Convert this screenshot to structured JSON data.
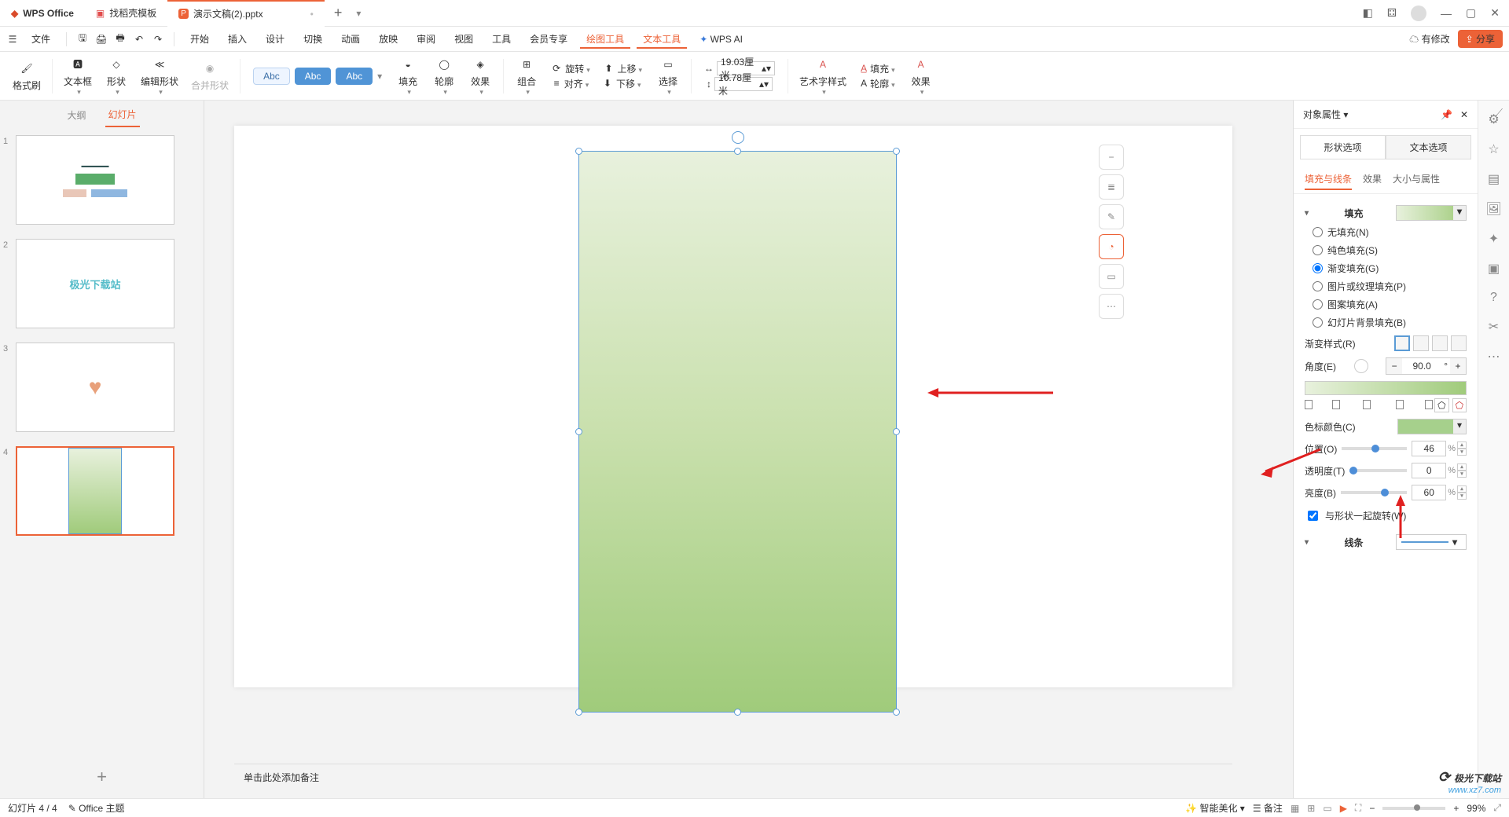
{
  "titlebar": {
    "office_tab": "WPS Office",
    "template_tab": "找稻壳模板",
    "doc_tab": "演示文稿(2).pptx"
  },
  "menubar": {
    "file": "文件",
    "items": [
      "开始",
      "插入",
      "设计",
      "切换",
      "动画",
      "放映",
      "审阅",
      "视图",
      "工具",
      "会员专享",
      "绘图工具",
      "文本工具",
      "WPS AI"
    ],
    "active_indices": [
      10,
      11
    ],
    "has_changes": "有修改",
    "share": "分享"
  },
  "ribbon": {
    "format_painter": "格式刷",
    "text_box": "文本框",
    "shape": "形状",
    "edit_shape": "编辑形状",
    "merge_shape": "合并形状",
    "abc": [
      "Abc",
      "Abc",
      "Abc"
    ],
    "fill": "填充",
    "outline": "轮廓",
    "effect": "效果",
    "group": "组合",
    "align": "对齐",
    "rotate": "旋转",
    "move_up": "上移",
    "move_down": "下移",
    "select": "选择",
    "width_val": "19.03厘米",
    "height_val": "10.78厘米",
    "art_style": "艺术字样式",
    "fill2": "填充",
    "outline2": "轮廓",
    "effect2": "效果"
  },
  "left_panel": {
    "tabs": [
      "大纲",
      "幻灯片"
    ],
    "active": 1,
    "slides": [
      1,
      2,
      3,
      4
    ],
    "current": 4
  },
  "canvas": {
    "notes_placeholder": "单击此处添加备注"
  },
  "right_panel": {
    "title": "对象属性",
    "tabs": [
      "形状选项",
      "文本选项"
    ],
    "subtabs": [
      "填充与线条",
      "效果",
      "大小与属性"
    ],
    "fill_section": "填充",
    "fill_options": {
      "none": "无填充(N)",
      "solid": "纯色填充(S)",
      "gradient": "渐变填充(G)",
      "picture": "图片或纹理填充(P)",
      "pattern": "图案填充(A)",
      "slide_bg": "幻灯片背景填充(B)"
    },
    "gradient_style": "渐变样式(R)",
    "angle": "角度(E)",
    "angle_val": "90.0",
    "angle_unit": "°",
    "stop_color": "色标颜色(C)",
    "position": "位置(O)",
    "position_val": "46",
    "transparency": "透明度(T)",
    "transparency_val": "0",
    "brightness": "亮度(B)",
    "brightness_val": "60",
    "percent": "%",
    "rotate_with_shape": "与形状一起旋转(W)",
    "line_section": "线条"
  },
  "statusbar": {
    "slide": "幻灯片 4 / 4",
    "theme": "Office 主题",
    "beautify": "智能美化",
    "notes": "备注",
    "zoom": "99%"
  },
  "watermark": {
    "line1": "极光下载站",
    "line2": "www.xz7.com"
  }
}
